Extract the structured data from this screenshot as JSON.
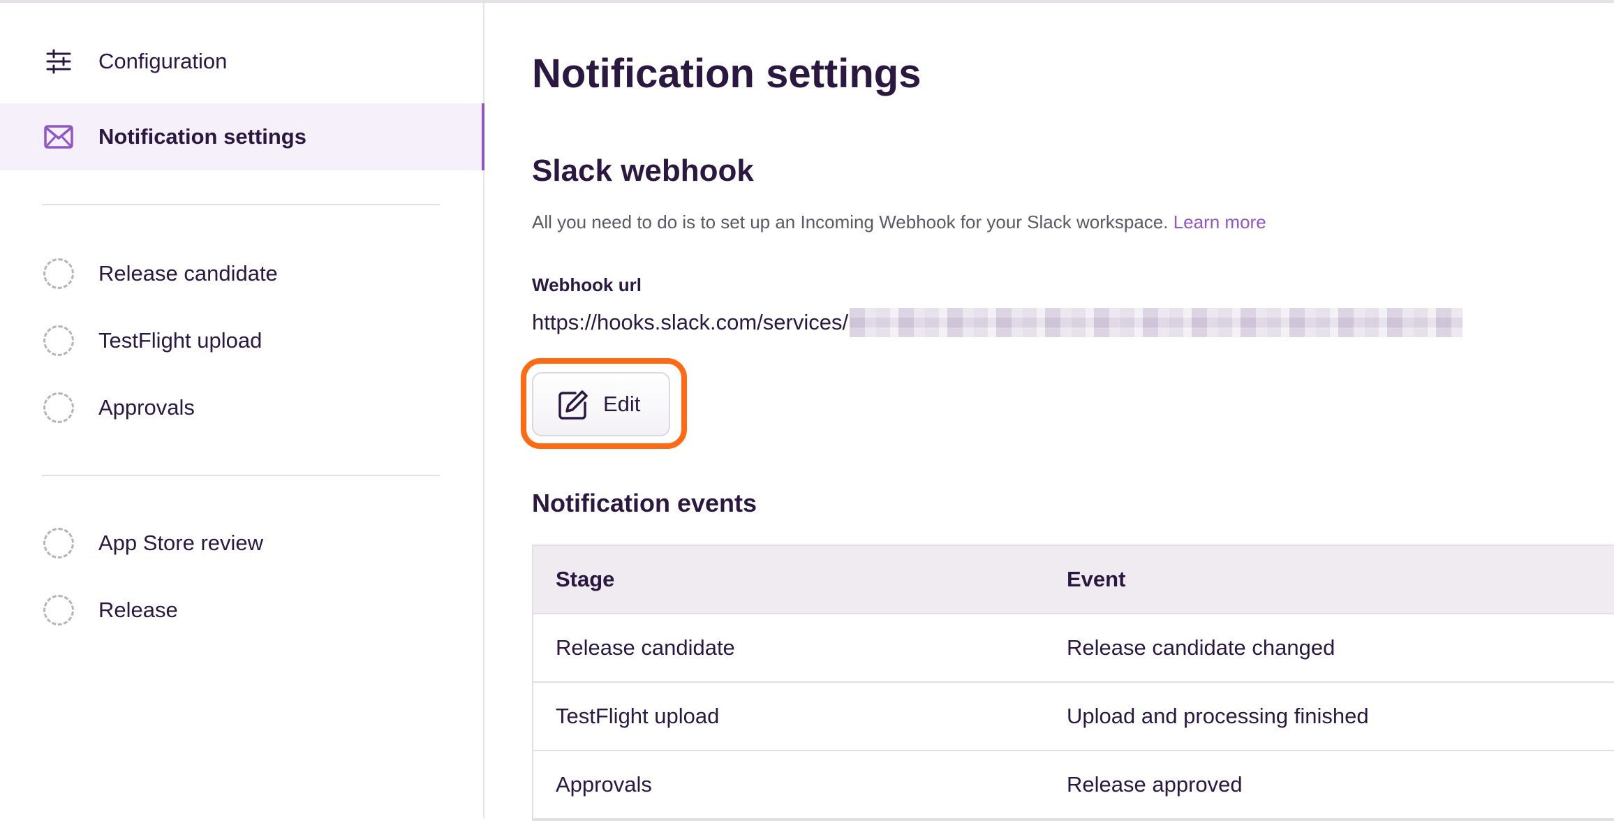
{
  "sidebar": {
    "items": [
      {
        "label": "Configuration",
        "icon": "sliders-icon"
      },
      {
        "label": "Notification settings",
        "icon": "envelope-icon",
        "active": true
      },
      {
        "label": "Release candidate",
        "icon": "dashed-circle-icon"
      },
      {
        "label": "TestFlight upload",
        "icon": "dashed-circle-icon"
      },
      {
        "label": "Approvals",
        "icon": "dashed-circle-icon"
      },
      {
        "label": "App Store review",
        "icon": "dashed-circle-icon"
      },
      {
        "label": "Release",
        "icon": "dashed-circle-icon"
      }
    ]
  },
  "main": {
    "title": "Notification settings",
    "slack": {
      "heading": "Slack webhook",
      "description": "All you need to do is to set up an Incoming Webhook for your Slack workspace.",
      "learn_more": "Learn more",
      "field_label": "Webhook url",
      "url_prefix": "https://hooks.slack.com/services/",
      "edit_label": "Edit"
    },
    "events": {
      "heading": "Notification events",
      "columns": [
        "Stage",
        "Event"
      ],
      "rows": [
        [
          "Release candidate",
          "Release candidate changed"
        ],
        [
          "TestFlight upload",
          "Upload and processing finished"
        ],
        [
          "Approvals",
          "Release approved"
        ]
      ]
    }
  },
  "colors": {
    "accent": "#8e56c6",
    "highlight": "#ff6a13",
    "text": "#2a1840",
    "active_bg": "#f6f0fb"
  }
}
